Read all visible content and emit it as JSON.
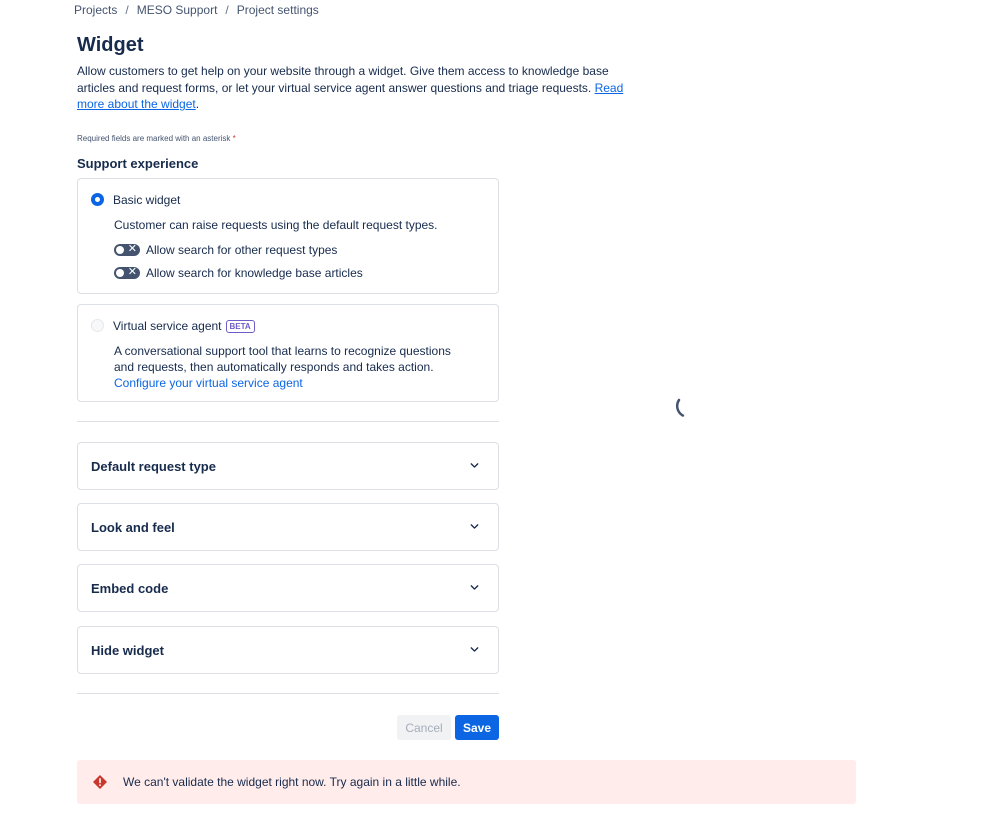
{
  "breadcrumb": {
    "items": [
      "Projects",
      "MESO Support",
      "Project settings"
    ],
    "separator": "/"
  },
  "page": {
    "title": "Widget",
    "description": "Allow customers to get help on your website through a widget. Give them access to knowledge base articles and request forms, or let your virtual service agent answer questions and triage requests. ",
    "read_more_link": "Read more about the widget",
    "required_note": "Required fields are marked with an asterisk",
    "asterisk": "*"
  },
  "support_experience": {
    "label": "Support experience",
    "basic": {
      "title": "Basic widget",
      "selected": true,
      "description": "Customer can raise requests using the default request types.",
      "toggles": [
        {
          "label": "Allow search for other request types",
          "enabled": false
        },
        {
          "label": "Allow search for knowledge base articles",
          "enabled": false
        }
      ]
    },
    "virtual": {
      "title": "Virtual service agent",
      "badge": "BETA",
      "selected": false,
      "description_line1": "A conversational support tool that learns to recognize questions",
      "description_line2": "and requests, then automatically responds and takes action.",
      "link": "Configure your virtual service agent"
    }
  },
  "accordions": [
    {
      "title": "Default request type"
    },
    {
      "title": "Look and feel"
    },
    {
      "title": "Embed code"
    },
    {
      "title": "Hide widget"
    }
  ],
  "actions": {
    "cancel": "Cancel",
    "save": "Save"
  },
  "error": {
    "message": "We can't validate the widget right now. Try again in a little while."
  },
  "icons": {
    "chevron": "chevron-down-icon",
    "error": "error-icon",
    "spinner": "loading-spinner-icon",
    "toggle_off": "toggle-off-icon"
  },
  "colors": {
    "link": "#0c66e4",
    "primary": "#0c66e4",
    "error_bg": "#ffeceb",
    "error_icon": "#c9372c",
    "badge": "#6e5dc6"
  }
}
